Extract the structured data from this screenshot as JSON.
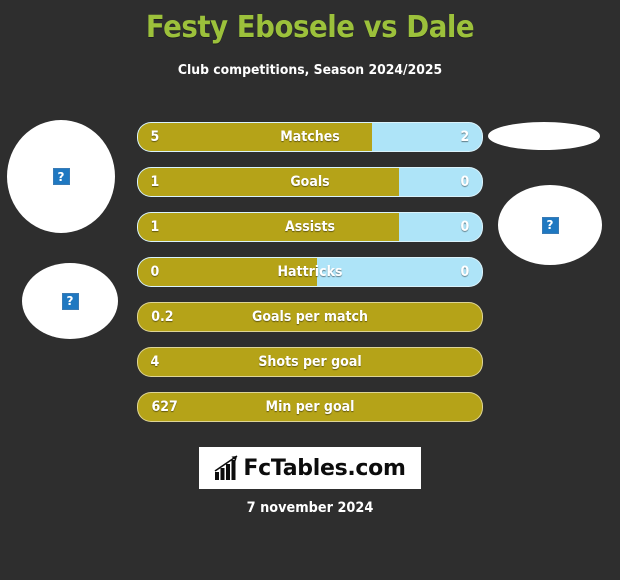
{
  "header": {
    "title": "Festy Ebosele vs Dale",
    "subtitle": "Club competitions, Season 2024/2025"
  },
  "colors": {
    "background": "#2e2e2e",
    "title_green": "#9cc13b",
    "home_gold": "#b5a318",
    "away_blue": "#aee4f8",
    "text_white": "#ffffff",
    "placeholder_blue": "#1f78c1"
  },
  "avatars": [
    {
      "name": "home-player-photo-top",
      "placeholder": "?"
    },
    {
      "name": "home-player-photo-bottom",
      "placeholder": "?"
    },
    {
      "name": "away-player-photo-top",
      "placeholder": ""
    },
    {
      "name": "away-player-photo-bottom",
      "placeholder": "?"
    }
  ],
  "stats": [
    {
      "label": "Matches",
      "home": "5",
      "away": "2",
      "home_pct": 68,
      "split": true
    },
    {
      "label": "Goals",
      "home": "1",
      "away": "0",
      "home_pct": 76,
      "split": true
    },
    {
      "label": "Assists",
      "home": "1",
      "away": "0",
      "home_pct": 76,
      "split": true
    },
    {
      "label": "Hattricks",
      "home": "0",
      "away": "0",
      "home_pct": 52,
      "split": true
    },
    {
      "label": "Goals per match",
      "home": "0.2",
      "away": "",
      "home_pct": 100,
      "split": false
    },
    {
      "label": "Shots per goal",
      "home": "4",
      "away": "",
      "home_pct": 100,
      "split": false
    },
    {
      "label": "Min per goal",
      "home": "627",
      "away": "",
      "home_pct": 100,
      "split": false
    }
  ],
  "logo": {
    "text": "FcTables.com",
    "icon": "bar-chart-growth-icon"
  },
  "footer": {
    "date": "7 november 2024"
  },
  "chart_data": {
    "type": "bar",
    "title": "Festy Ebosele vs Dale",
    "subtitle": "Club competitions, Season 2024/2025",
    "categories": [
      "Matches",
      "Goals",
      "Assists",
      "Hattricks",
      "Goals per match",
      "Shots per goal",
      "Min per goal"
    ],
    "series": [
      {
        "name": "Festy Ebosele",
        "values": [
          5,
          1,
          1,
          0,
          0.2,
          4,
          627
        ]
      },
      {
        "name": "Dale",
        "values": [
          2,
          0,
          0,
          0,
          null,
          null,
          null
        ]
      }
    ],
    "legend_position": "none",
    "grid": false,
    "xlabel": "",
    "ylabel": ""
  }
}
